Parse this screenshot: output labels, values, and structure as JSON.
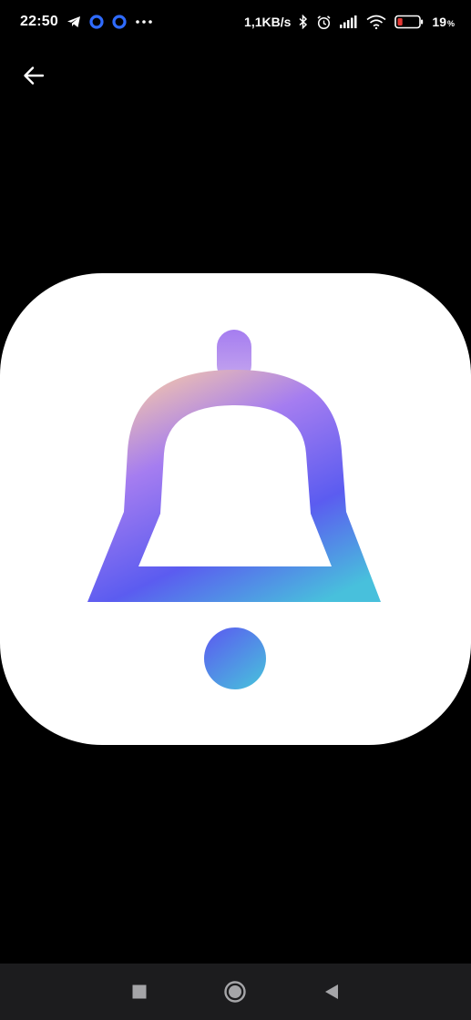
{
  "status_bar": {
    "time": "22:50",
    "network_speed": "1,1KB/s",
    "battery_level": "19",
    "battery_unit": "%",
    "battery_fill_fraction": 0.19,
    "colors": {
      "notification_ring": "#2f6bff",
      "battery_low": "#e53935"
    },
    "icons": [
      "telegram-icon",
      "notification-ring-icon",
      "notification-ring-icon",
      "more-dots-icon",
      "bluetooth-icon",
      "alarm-icon",
      "signal-icon",
      "wifi-icon",
      "battery-icon"
    ]
  },
  "app_bar": {
    "back_icon": "arrow-left-icon"
  },
  "image": {
    "description_icon": "bell-icon",
    "colors": {
      "card_background": "#ffffff",
      "gradient_top": "#f6c8a8",
      "gradient_mid": "#a57df0",
      "gradient_low": "#5b5cf0",
      "gradient_bottom": "#48c0dc"
    }
  },
  "nav_bar": {
    "buttons": [
      "recents-square-icon",
      "home-circle-icon",
      "back-triangle-icon"
    ]
  }
}
